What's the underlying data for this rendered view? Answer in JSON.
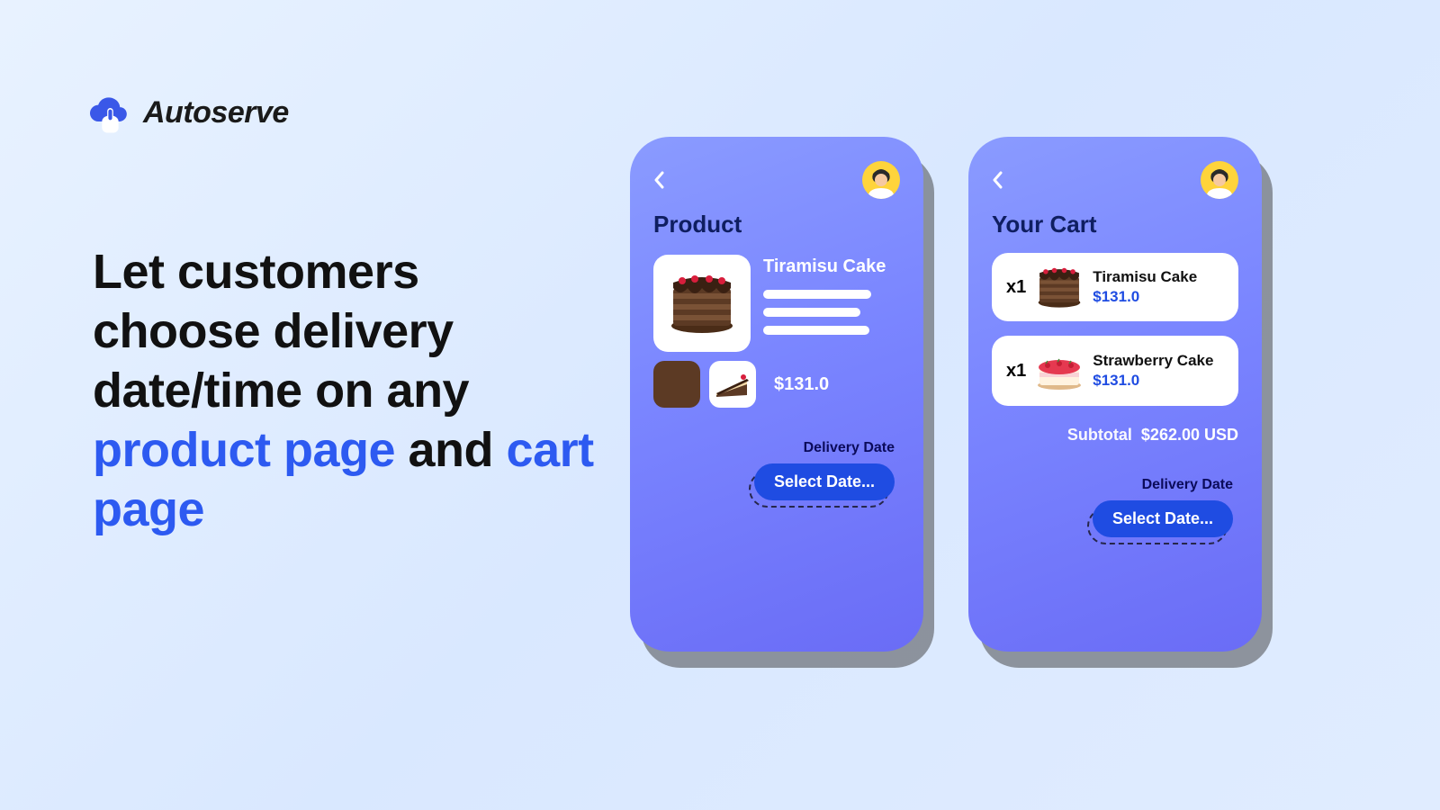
{
  "brand": {
    "name": "Autoserve"
  },
  "headline": {
    "line1": "Let customers choose delivery date/time on any",
    "accent1": "product page",
    "connector": " and",
    "accent2": "cart page"
  },
  "phone_product": {
    "title": "Product",
    "product_name": "Tiramisu Cake",
    "price": "$131.0",
    "delivery_label": "Delivery Date",
    "select_label": "Select Date..."
  },
  "phone_cart": {
    "title": "Your Cart",
    "items": [
      {
        "qty": "x1",
        "name": "Tiramisu Cake",
        "price": "$131.0"
      },
      {
        "qty": "x1",
        "name": "Strawberry Cake",
        "price": "$131.0"
      }
    ],
    "subtotal_label": "Subtotal",
    "subtotal_value": "$262.00 USD",
    "delivery_label": "Delivery Date",
    "select_label": "Select Date..."
  }
}
